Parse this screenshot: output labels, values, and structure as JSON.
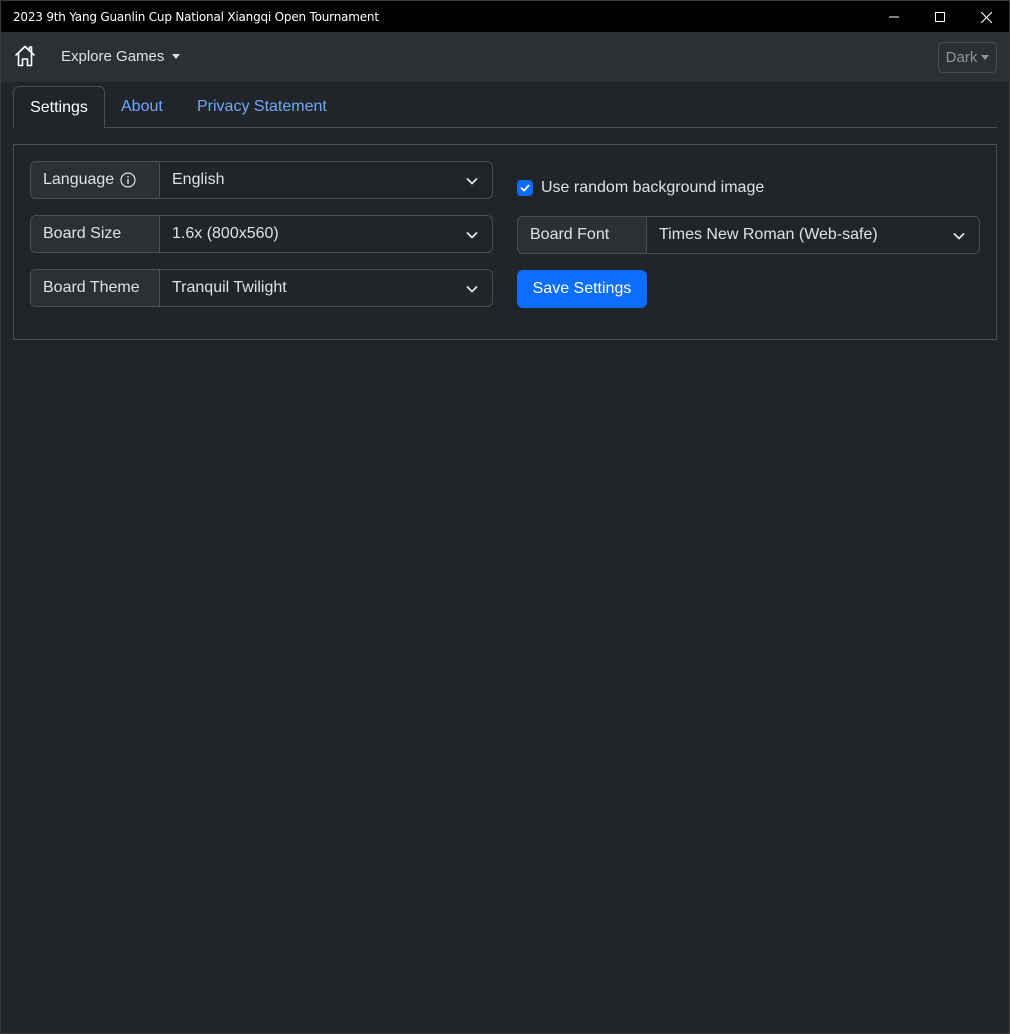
{
  "window": {
    "title": "2023 9th Yang Guanlin Cup National Xiangqi Open Tournament",
    "controls": [
      "minimize-icon",
      "maximize-icon",
      "close-icon"
    ]
  },
  "navbar": {
    "home_icon": "home-icon",
    "explore_label": "Explore Games",
    "theme_label": "Dark"
  },
  "tabs": [
    {
      "label": "Settings",
      "active": true
    },
    {
      "label": "About",
      "active": false
    },
    {
      "label": "Privacy Statement",
      "active": false
    }
  ],
  "settings": {
    "language": {
      "label": "Language",
      "value": "English",
      "info_icon": "info-icon"
    },
    "board_size": {
      "label": "Board Size",
      "value": "1.6x (800x560)"
    },
    "board_theme": {
      "label": "Board Theme",
      "value": "Tranquil Twilight"
    },
    "random_background": {
      "label": "Use random background image",
      "checked": true
    },
    "board_font": {
      "label": "Board Font",
      "value": "Times New Roman (Web-safe)"
    },
    "save_label": "Save Settings"
  },
  "colors": {
    "background": "#212529",
    "navbar": "#2b3035",
    "accent": "#0d6efd",
    "link": "#6ea8fe",
    "titlebar": "#000000"
  }
}
